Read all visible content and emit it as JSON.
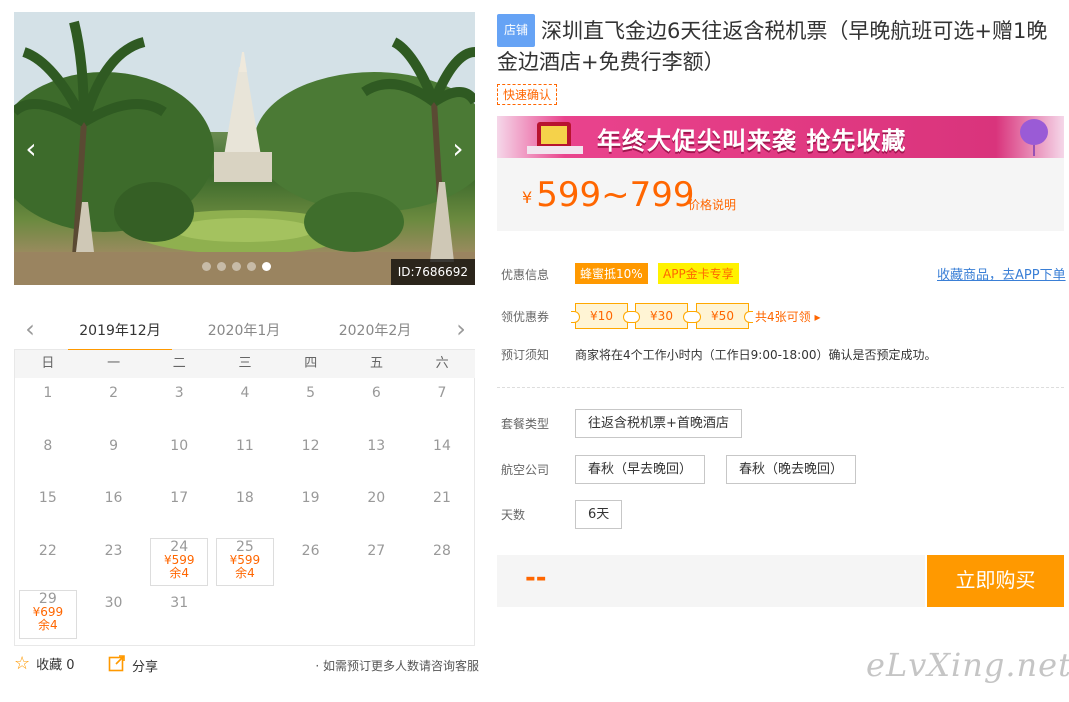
{
  "gallery": {
    "id_label": "ID:7686692",
    "prev_arrow": "‹",
    "next_arrow": "›",
    "dot_count": 5,
    "active_dot": 4
  },
  "calendar": {
    "prev": "‹",
    "next": "›",
    "months": [
      "2019年12月",
      "2020年1月",
      "2020年2月"
    ],
    "active_month": 0,
    "weekdays": [
      "日",
      "一",
      "二",
      "三",
      "四",
      "五",
      "六"
    ],
    "weeks": [
      [
        {
          "d": "1"
        },
        {
          "d": "2"
        },
        {
          "d": "3"
        },
        {
          "d": "4"
        },
        {
          "d": "5"
        },
        {
          "d": "6"
        },
        {
          "d": "7"
        }
      ],
      [
        {
          "d": "8"
        },
        {
          "d": "9"
        },
        {
          "d": "10"
        },
        {
          "d": "11"
        },
        {
          "d": "12"
        },
        {
          "d": "13"
        },
        {
          "d": "14"
        }
      ],
      [
        {
          "d": "15"
        },
        {
          "d": "16"
        },
        {
          "d": "17"
        },
        {
          "d": "18"
        },
        {
          "d": "19"
        },
        {
          "d": "20"
        },
        {
          "d": "21"
        }
      ],
      [
        {
          "d": "22"
        },
        {
          "d": "23"
        },
        {
          "d": "24",
          "price": "¥599",
          "left": "余4"
        },
        {
          "d": "25",
          "price": "¥599",
          "left": "余4"
        },
        {
          "d": "26"
        },
        {
          "d": "27"
        },
        {
          "d": "28"
        }
      ],
      [
        {
          "d": "29",
          "price": "¥699",
          "left": "余4"
        },
        {
          "d": "30"
        },
        {
          "d": "31"
        }
      ]
    ]
  },
  "actions": {
    "favorite": "收藏 0",
    "share": "分享",
    "consult": "· 如需预订更多人数请咨询客服"
  },
  "product": {
    "shop_tag": "店铺",
    "title": "深圳直飞金边6天往返含税机票（早晚航班可选+赠1晚金边酒店+免费行李额）",
    "fast_confirm": "快速确认"
  },
  "banner": {
    "text": "年终大促尖叫来袭  抢先收藏"
  },
  "price": {
    "currency": "¥",
    "range": "599~799",
    "note": "价格说明"
  },
  "discount": {
    "label": "优惠信息",
    "tags": [
      "蜂蜜抵10%",
      "APP金卡专享"
    ],
    "fav_app": "收藏商品，去APP下单"
  },
  "coupons": {
    "label": "领优惠券",
    "items": [
      "¥10",
      "¥30",
      "¥50"
    ],
    "more": "共4张可领 ▸"
  },
  "booking": {
    "label": "预订须知",
    "text": "商家将在4个工作小时内（工作日9:00-18:00）确认是否预定成功。"
  },
  "package": {
    "label": "套餐类型",
    "options": [
      "往返含税机票+首晚酒店"
    ]
  },
  "airline": {
    "label": "航空公司",
    "options": [
      "春秋（早去晚回）",
      "春秋（晚去晚回）"
    ]
  },
  "days": {
    "label": "天数",
    "options": [
      "6天"
    ]
  },
  "buy": {
    "total": "--",
    "button": "立即购买"
  },
  "watermark": "eLvXing.net",
  "colors": {
    "accent": "#ff9900",
    "price": "#ff6600",
    "link": "#3a7fd6",
    "shop_tag": "#66a3f5"
  }
}
